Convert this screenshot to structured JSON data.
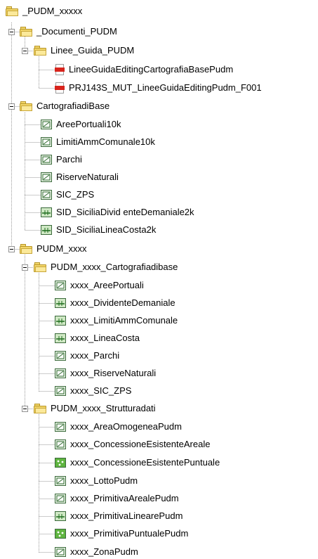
{
  "tree": {
    "nodes": [
      {
        "label": "_PUDM_xxxxx",
        "icon": "folder-icon",
        "type": "folder"
      },
      {
        "label": "_Documenti_PUDM",
        "icon": "folder-icon",
        "type": "folder"
      },
      {
        "label": "Linee_Guida_PUDM",
        "icon": "folder-icon",
        "type": "folder"
      },
      {
        "label": "LineeGuidaEditingCartografiaBasePudm",
        "icon": "pdf-file-icon",
        "type": "pdf"
      },
      {
        "label": "PRJ143S_MUT_LineeGuidaEditingPudm_F001",
        "icon": "pdf-file-icon",
        "type": "pdf"
      },
      {
        "label": "CartografiadiBase",
        "icon": "folder-icon",
        "type": "folder"
      },
      {
        "label": "AreePortuali10k",
        "icon": "polygon-layer-icon",
        "type": "polygon"
      },
      {
        "label": "LimitiAmmComunale10k",
        "icon": "polygon-layer-icon",
        "type": "polygon"
      },
      {
        "label": "Parchi",
        "icon": "polygon-layer-icon",
        "type": "polygon"
      },
      {
        "label": "RiserveNaturali",
        "icon": "polygon-layer-icon",
        "type": "polygon"
      },
      {
        "label": "SIC_ZPS",
        "icon": "polygon-layer-icon",
        "type": "polygon"
      },
      {
        "label": "SID_SiciliaDivid enteDemaniale2k",
        "icon": "line-layer-icon",
        "type": "line"
      },
      {
        "label": "SID_SiciliaLineaCosta2k",
        "icon": "line-layer-icon",
        "type": "line"
      },
      {
        "label": "PUDM_xxxx",
        "icon": "folder-icon",
        "type": "folder"
      },
      {
        "label": "PUDM_xxxx_Cartografiadibase",
        "icon": "folder-icon",
        "type": "folder"
      },
      {
        "label": "xxxx_AreePortuali",
        "icon": "polygon-layer-icon",
        "type": "polygon"
      },
      {
        "label": "xxxx_DividenteDemaniale",
        "icon": "line-layer-icon",
        "type": "line"
      },
      {
        "label": "xxxx_LimitiAmmComunale",
        "icon": "line-layer-icon",
        "type": "line"
      },
      {
        "label": "xxxx_LineaCosta",
        "icon": "line-layer-icon",
        "type": "line"
      },
      {
        "label": "xxxx_Parchi",
        "icon": "polygon-layer-icon",
        "type": "polygon"
      },
      {
        "label": "xxxx_RiserveNaturali",
        "icon": "polygon-layer-icon",
        "type": "polygon"
      },
      {
        "label": "xxxx_SIC_ZPS",
        "icon": "polygon-layer-icon",
        "type": "polygon"
      },
      {
        "label": "PUDM_xxxx_Strutturadati",
        "icon": "folder-icon",
        "type": "folder"
      },
      {
        "label": "xxxx_AreaOmogeneaPudm",
        "icon": "polygon-layer-icon",
        "type": "polygon"
      },
      {
        "label": "xxxx_ConcessioneEsistenteAreale",
        "icon": "polygon-layer-icon",
        "type": "polygon"
      },
      {
        "label": "xxxx_ConcessioneEsistentePuntuale",
        "icon": "point-layer-icon",
        "type": "point"
      },
      {
        "label": "xxxx_LottoPudm",
        "icon": "polygon-layer-icon",
        "type": "polygon"
      },
      {
        "label": "xxxx_PrimitivaArealePudm",
        "icon": "polygon-layer-icon",
        "type": "polygon"
      },
      {
        "label": "xxxx_PrimitivaLinearePudm",
        "icon": "line-layer-icon",
        "type": "line"
      },
      {
        "label": "xxxx_PrimitivaPuntualePudm",
        "icon": "point-layer-icon",
        "type": "point"
      },
      {
        "label": "xxxx_ZonaPudm",
        "icon": "polygon-layer-icon",
        "type": "polygon"
      }
    ]
  }
}
